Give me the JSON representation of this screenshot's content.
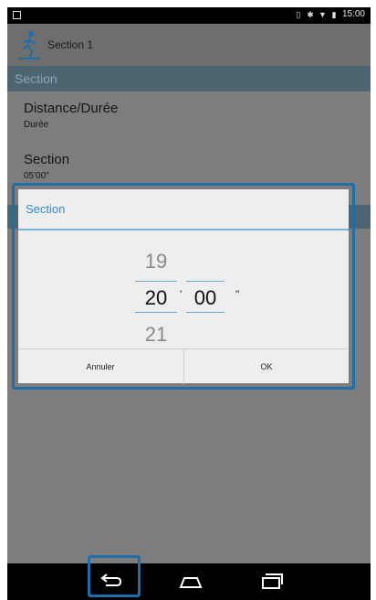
{
  "status_bar": {
    "time": "15:00"
  },
  "app_bar": {
    "title": "Section 1"
  },
  "section_header": "Section",
  "list": [
    {
      "label": "Distance/Durée",
      "value": "Durée"
    },
    {
      "label": "Section",
      "value": "05'00\""
    }
  ],
  "dialog": {
    "title": "Section",
    "minutes": {
      "prev": "19",
      "current": "20",
      "next": "21"
    },
    "minute_mark": "'",
    "seconds": {
      "current": "00"
    },
    "second_mark": "\"",
    "buttons": {
      "cancel": "Annuler",
      "ok": "OK"
    }
  },
  "nav_bar": {
    "icons": [
      "back-icon",
      "home-icon",
      "recents-icon"
    ]
  },
  "colors": {
    "accent": "#2d8ed1",
    "highlight_outline": "#1f6ea6",
    "section_header_bg": "#4d6471"
  }
}
